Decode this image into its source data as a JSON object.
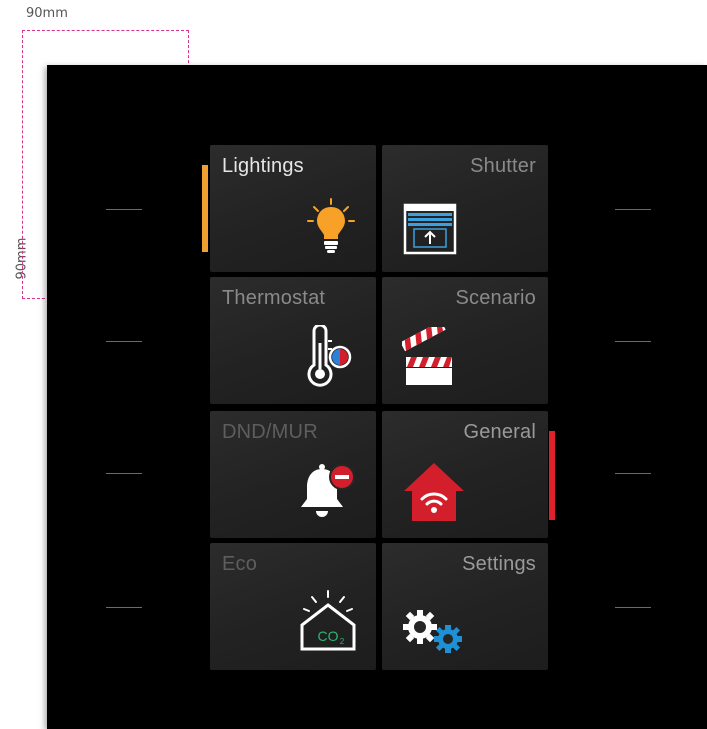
{
  "dimensions": {
    "width_label": "90mm",
    "height_label": "90mm"
  },
  "tiles": [
    {
      "label": "Lightings",
      "label_color": "#e6e6e6",
      "icon": "light-bulb-icon"
    },
    {
      "label": "Shutter",
      "label_color": "#8a8a8a",
      "icon": "shutter-icon"
    },
    {
      "label": "Thermostat",
      "label_color": "#8a8a8a",
      "icon": "thermometer-icon"
    },
    {
      "label": "Scenario",
      "label_color": "#8a8a8a",
      "icon": "clapperboard-icon"
    },
    {
      "label": "DND/MUR",
      "label_color": "#5e5e5e",
      "icon": "bell-dnd-icon"
    },
    {
      "label": "General",
      "label_color": "#9a9a9a",
      "icon": "home-wifi-icon"
    },
    {
      "label": "Eco",
      "label_color": "#5e5e5e",
      "icon": "eco-co2-icon"
    },
    {
      "label": "Settings",
      "label_color": "#9a9a9a",
      "icon": "settings-gears-icon"
    }
  ],
  "indicators": {
    "left_color": "#f0a030",
    "right_color": "#e0202a"
  },
  "colors": {
    "panel": "#000000",
    "tile": "#262626",
    "bulb": "#f7a128",
    "home": "#d31f2b",
    "co2": "#2bb673",
    "gear_blue": "#1e90d6",
    "shutter_blue": "#3aa0e0"
  }
}
